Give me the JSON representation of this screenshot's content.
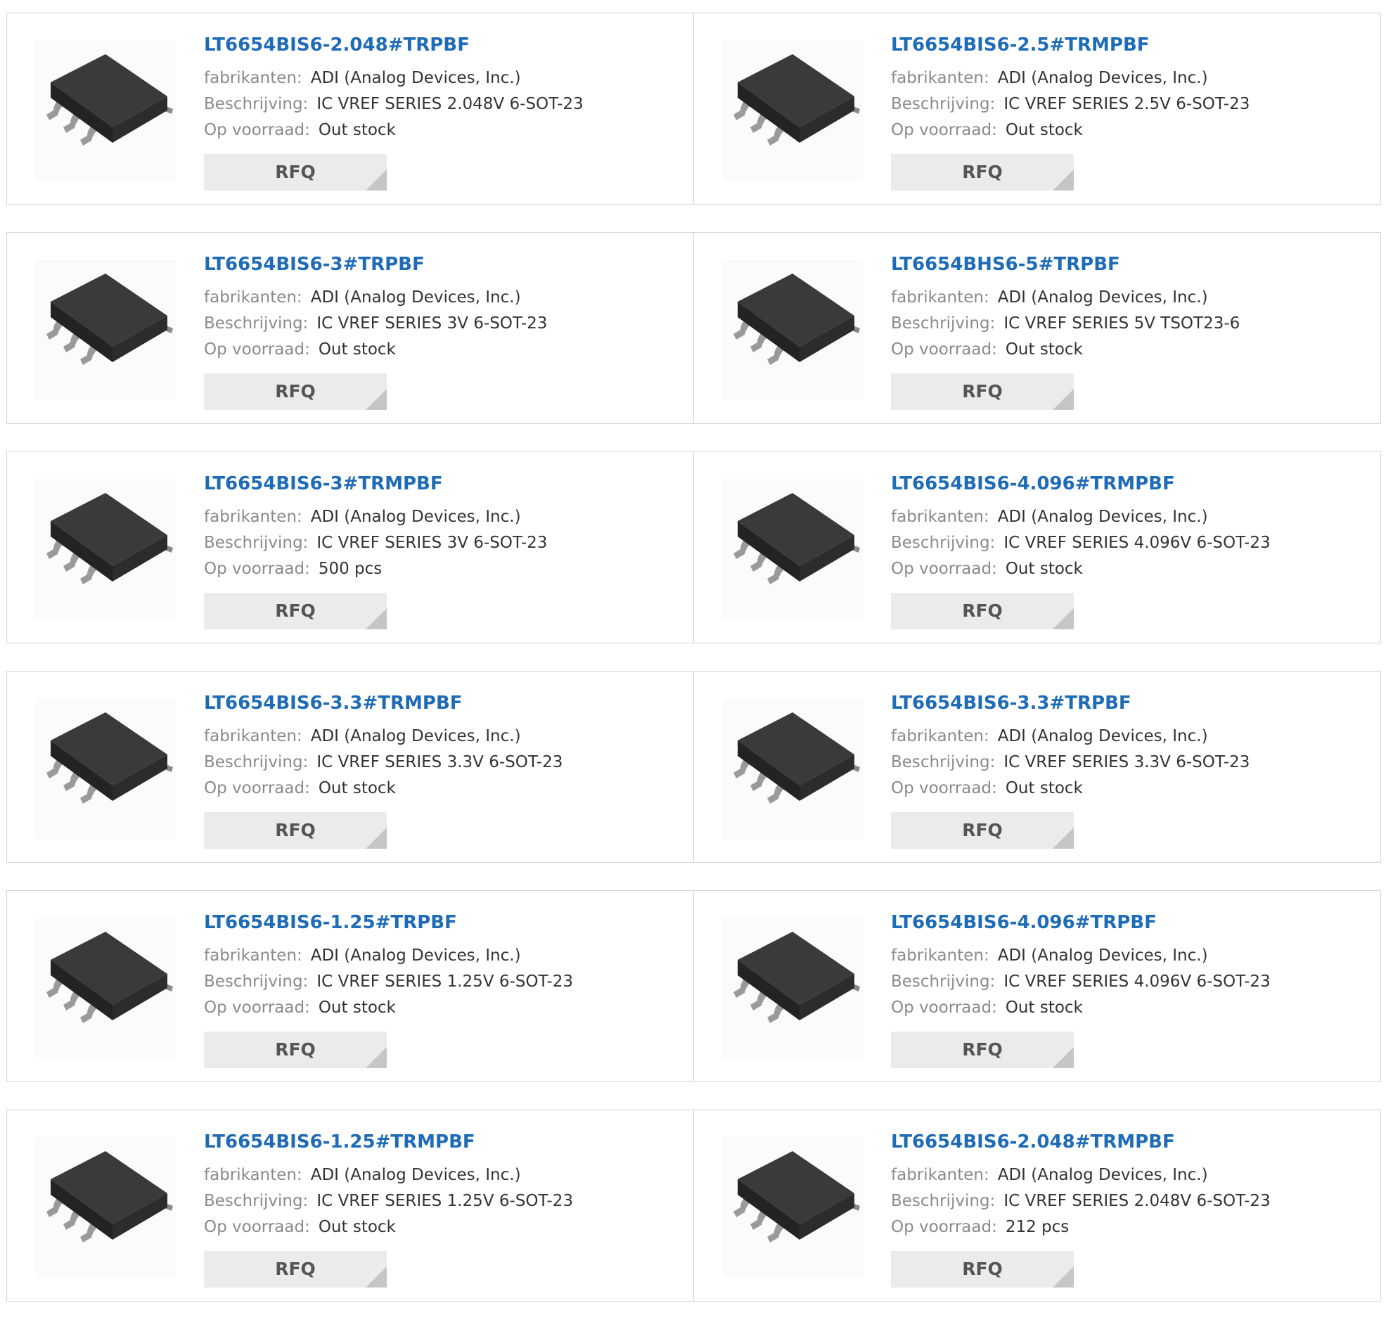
{
  "labels": {
    "manufacturer": "fabrikanten:",
    "description": "Beschrijving:",
    "stock": "Op voorraad:",
    "rfq": "RFQ"
  },
  "colors": {
    "part_number": "#1e6bb8",
    "label": "#8a8a8a",
    "value": "#333333",
    "button_bg": "#ebebeb",
    "border": "#d4d4d4"
  },
  "image_icon": "sot23-6-chip-icon",
  "products": [
    {
      "part": "LT6654BIS6-2.048#TRPBF",
      "manufacturer": "ADI (Analog Devices, Inc.)",
      "description": "IC VREF SERIES 2.048V 6-SOT-23",
      "stock": "Out stock"
    },
    {
      "part": "LT6654BIS6-2.5#TRMPBF",
      "manufacturer": "ADI (Analog Devices, Inc.)",
      "description": "IC VREF SERIES 2.5V 6-SOT-23",
      "stock": "Out stock"
    },
    {
      "part": "LT6654BIS6-3#TRPBF",
      "manufacturer": "ADI (Analog Devices, Inc.)",
      "description": "IC VREF SERIES 3V 6-SOT-23",
      "stock": "Out stock"
    },
    {
      "part": "LT6654BHS6-5#TRPBF",
      "manufacturer": "ADI (Analog Devices, Inc.)",
      "description": "IC VREF SERIES 5V TSOT23-6",
      "stock": "Out stock"
    },
    {
      "part": "LT6654BIS6-3#TRMPBF",
      "manufacturer": "ADI (Analog Devices, Inc.)",
      "description": "IC VREF SERIES 3V 6-SOT-23",
      "stock": "500 pcs"
    },
    {
      "part": "LT6654BIS6-4.096#TRMPBF",
      "manufacturer": "ADI (Analog Devices, Inc.)",
      "description": "IC VREF SERIES 4.096V 6-SOT-23",
      "stock": "Out stock"
    },
    {
      "part": "LT6654BIS6-3.3#TRMPBF",
      "manufacturer": "ADI (Analog Devices, Inc.)",
      "description": "IC VREF SERIES 3.3V 6-SOT-23",
      "stock": "Out stock"
    },
    {
      "part": "LT6654BIS6-3.3#TRPBF",
      "manufacturer": "ADI (Analog Devices, Inc.)",
      "description": "IC VREF SERIES 3.3V 6-SOT-23",
      "stock": "Out stock"
    },
    {
      "part": "LT6654BIS6-1.25#TRPBF",
      "manufacturer": "ADI (Analog Devices, Inc.)",
      "description": "IC VREF SERIES 1.25V 6-SOT-23",
      "stock": "Out stock"
    },
    {
      "part": "LT6654BIS6-4.096#TRPBF",
      "manufacturer": "ADI (Analog Devices, Inc.)",
      "description": "IC VREF SERIES 4.096V 6-SOT-23",
      "stock": "Out stock"
    },
    {
      "part": "LT6654BIS6-1.25#TRMPBF",
      "manufacturer": "ADI (Analog Devices, Inc.)",
      "description": "IC VREF SERIES 1.25V 6-SOT-23",
      "stock": "Out stock"
    },
    {
      "part": "LT6654BIS6-2.048#TRMPBF",
      "manufacturer": "ADI (Analog Devices, Inc.)",
      "description": "IC VREF SERIES 2.048V 6-SOT-23",
      "stock": "212 pcs"
    }
  ]
}
